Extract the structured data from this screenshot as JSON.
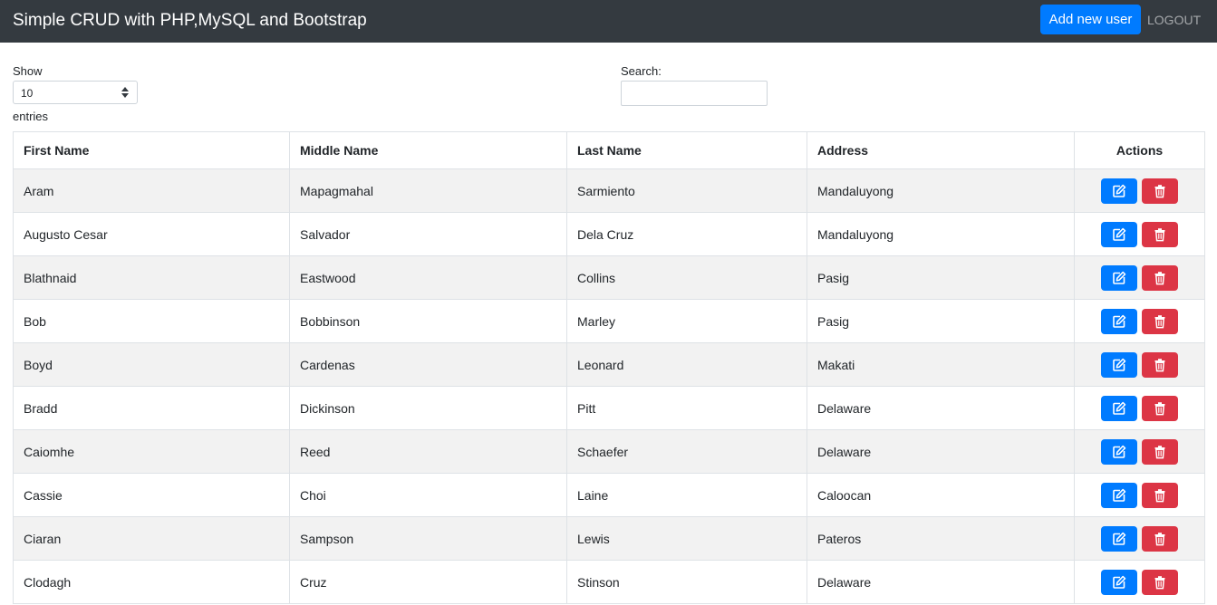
{
  "navbar": {
    "title": "Simple CRUD with PHP,MySQL and Bootstrap",
    "add_button": "Add new user",
    "logout": "LOGOUT"
  },
  "controls": {
    "show_label": "Show",
    "page_size": "10",
    "entries_label": "entries",
    "search_label": "Search:",
    "search_value": ""
  },
  "table": {
    "headers": [
      "First Name",
      "Middle Name",
      "Last Name",
      "Address",
      "Actions"
    ],
    "rows": [
      [
        "Aram",
        "Mapagmahal",
        "Sarmiento",
        "Mandaluyong"
      ],
      [
        "Augusto Cesar",
        "Salvador",
        "Dela Cruz",
        "Mandaluyong"
      ],
      [
        "Blathnaid",
        "Eastwood",
        "Collins",
        "Pasig"
      ],
      [
        "Bob",
        "Bobbinson",
        "Marley",
        "Pasig"
      ],
      [
        "Boyd",
        "Cardenas",
        "Leonard",
        "Makati"
      ],
      [
        "Bradd",
        "Dickinson",
        "Pitt",
        "Delaware"
      ],
      [
        "Caiomhe",
        "Reed",
        "Schaefer",
        "Delaware"
      ],
      [
        "Cassie",
        "Choi",
        "Laine",
        "Caloocan"
      ],
      [
        "Ciaran",
        "Sampson",
        "Lewis",
        "Pateros"
      ],
      [
        "Clodagh",
        "Cruz",
        "Stinson",
        "Delaware"
      ]
    ]
  },
  "icons": {
    "edit": "edit-icon",
    "delete": "trash-icon",
    "select_arrows": "sort-arrows-icon"
  },
  "colors": {
    "navbar": "#343a40",
    "primary": "#007bff",
    "danger": "#dc3545",
    "stripe": "#f2f2f2"
  }
}
